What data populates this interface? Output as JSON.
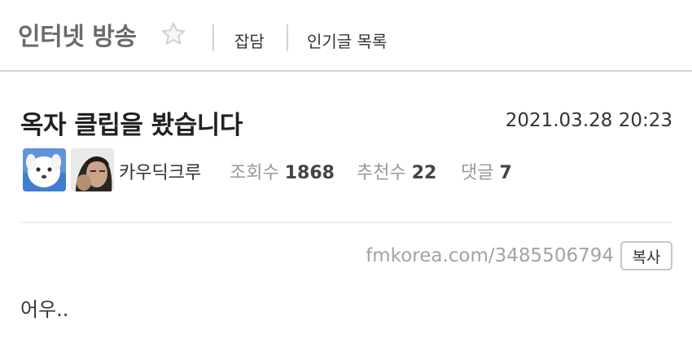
{
  "header": {
    "board_title": "인터넷 방송",
    "nav": [
      {
        "label": "잡담"
      },
      {
        "label": "인기글 목록"
      }
    ]
  },
  "post": {
    "title": "옥자 클립을 봤습니다",
    "date": "2021.03.28 20:23",
    "author": "카우딕크루",
    "stats": {
      "views_label": "조회수",
      "views": "1868",
      "recommend_label": "추천수",
      "recommend": "22",
      "comments_label": "댓글",
      "comments": "7"
    },
    "url": "fmkorea.com/3485506794",
    "copy_label": "복사",
    "body": "어우.."
  },
  "icons": {
    "favorite": "star-outline-icon",
    "avatar_primary": "dog-avatar",
    "avatar_secondary": "person-avatar"
  },
  "colors": {
    "board_title": "#6a6a6a",
    "muted": "#999999",
    "url": "#a3a3a3",
    "divider": "#d4d4d4"
  }
}
